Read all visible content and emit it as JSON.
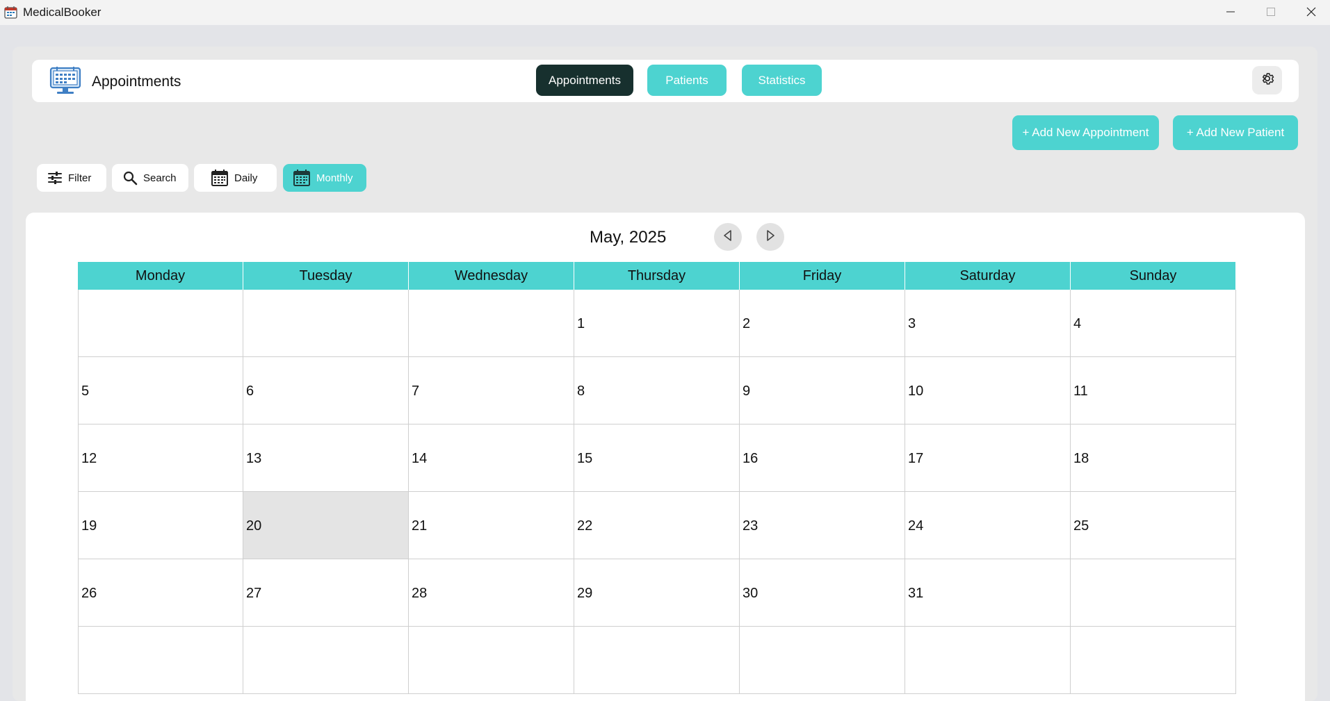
{
  "window": {
    "title": "MedicalBooker"
  },
  "header": {
    "title": "Appointments",
    "nav": [
      {
        "label": "Appointments",
        "active": true
      },
      {
        "label": "Patients",
        "active": false
      },
      {
        "label": "Statistics",
        "active": false
      }
    ],
    "settings_icon": "gear-icon"
  },
  "actions": {
    "add_appointment": "+ Add New Appointment",
    "add_patient": "+ Add New Patient"
  },
  "toolbar": {
    "filter": "Filter",
    "search": "Search",
    "daily": "Daily",
    "monthly": "Monthly",
    "active_view": "Monthly"
  },
  "calendar": {
    "month_label": "May, 2025",
    "weekdays": [
      "Monday",
      "Tuesday",
      "Wednesday",
      "Thursday",
      "Friday",
      "Saturday",
      "Sunday"
    ],
    "weeks": [
      [
        "",
        "",
        "",
        "1",
        "2",
        "3",
        "4"
      ],
      [
        "5",
        "6",
        "7",
        "8",
        "9",
        "10",
        "11"
      ],
      [
        "12",
        "13",
        "14",
        "15",
        "16",
        "17",
        "18"
      ],
      [
        "19",
        "20",
        "21",
        "22",
        "23",
        "24",
        "25"
      ],
      [
        "26",
        "27",
        "28",
        "29",
        "30",
        "31",
        ""
      ],
      [
        "",
        "",
        "",
        "",
        "",
        "",
        ""
      ]
    ],
    "highlighted_day": "20"
  },
  "colors": {
    "accent": "#4dd3d0",
    "active_nav": "#17302e",
    "today_cell": "#e4e4e4"
  }
}
